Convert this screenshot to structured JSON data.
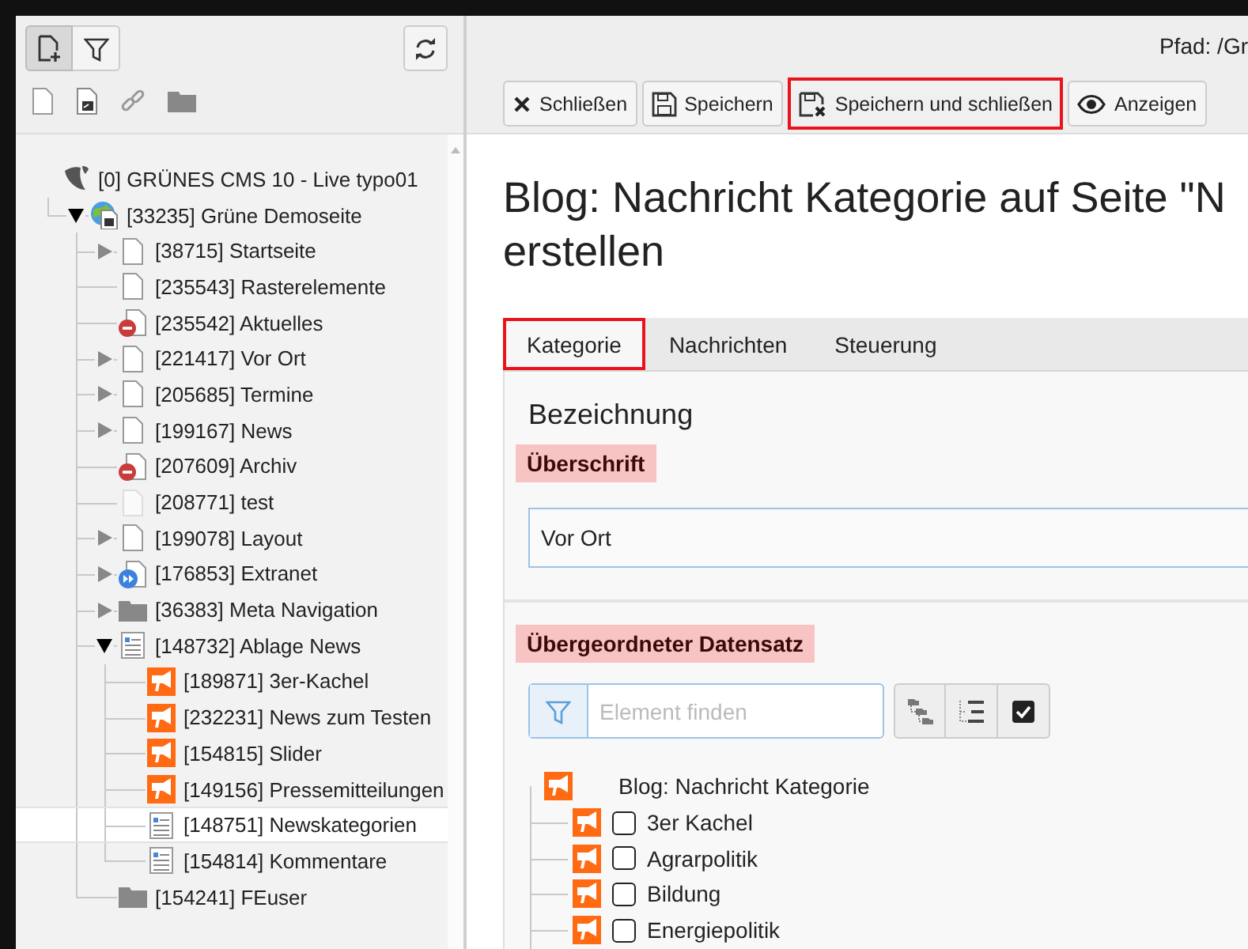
{
  "page_tree": {
    "items": [
      {
        "label": "[0] GRÜNES CMS 10 - Live typo01",
        "kind": "logo",
        "selected": false,
        "children": [
          {
            "label": "[33235] Grüne Demoseite",
            "kind": "globe-page",
            "expandable": true,
            "expanded": true,
            "selected": false,
            "children": [
              {
                "label": "[38715] Startseite",
                "kind": "page",
                "expandable": true,
                "expanded": false,
                "selected": false
              },
              {
                "label": "[235543] Rasterelemente",
                "kind": "page",
                "expandable": false,
                "expanded": false,
                "selected": false
              },
              {
                "label": "[235542] Aktuelles",
                "kind": "page-blocked",
                "expandable": false,
                "expanded": false,
                "selected": false
              },
              {
                "label": "[221417] Vor Ort",
                "kind": "page",
                "expandable": true,
                "expanded": false,
                "selected": false
              },
              {
                "label": "[205685] Termine",
                "kind": "page",
                "expandable": true,
                "expanded": false,
                "selected": false
              },
              {
                "label": "[199167] News",
                "kind": "page",
                "expandable": true,
                "expanded": false,
                "selected": false
              },
              {
                "label": "[207609] Archiv",
                "kind": "page-blocked",
                "expandable": false,
                "expanded": false,
                "selected": false
              },
              {
                "label": "[208771] test",
                "kind": "page-faded",
                "expandable": false,
                "expanded": false,
                "selected": false
              },
              {
                "label": "[199078] Layout",
                "kind": "page",
                "expandable": true,
                "expanded": false,
                "selected": false
              },
              {
                "label": "[176853] Extranet",
                "kind": "page-forward",
                "expandable": true,
                "expanded": false,
                "selected": false
              },
              {
                "label": "[36383] Meta Navigation",
                "kind": "folder",
                "expandable": true,
                "expanded": false,
                "selected": false
              },
              {
                "label": "[148732] Ablage News",
                "kind": "list-page",
                "expandable": true,
                "expanded": true,
                "selected": false,
                "children": [
                  {
                    "label": "[189871] 3er-Kachel",
                    "kind": "megaphone",
                    "expandable": false,
                    "expanded": false,
                    "selected": false
                  },
                  {
                    "label": "[232231] News zum Testen",
                    "kind": "megaphone",
                    "expandable": false,
                    "expanded": false,
                    "selected": false
                  },
                  {
                    "label": "[154815] Slider",
                    "kind": "megaphone",
                    "expandable": false,
                    "expanded": false,
                    "selected": false
                  },
                  {
                    "label": "[149156] Pressemitteilungen",
                    "kind": "megaphone",
                    "expandable": false,
                    "expanded": false,
                    "selected": false
                  },
                  {
                    "label": "[148751] Newskategorien",
                    "kind": "list-page",
                    "expandable": false,
                    "expanded": false,
                    "selected": true
                  },
                  {
                    "label": "[154814] Kommentare",
                    "kind": "list-page",
                    "expandable": false,
                    "expanded": false,
                    "selected": false
                  }
                ]
              },
              {
                "label": "[154241] FEuser",
                "kind": "folder",
                "expandable": false,
                "expanded": false,
                "selected": false
              }
            ]
          }
        ]
      }
    ]
  },
  "path": "Pfad: /Gr",
  "buttons": [
    {
      "label": "Schließen",
      "kind": "close",
      "highlighted": false
    },
    {
      "label": "Speichern",
      "kind": "save",
      "highlighted": false
    },
    {
      "label": "Speichern und schließen",
      "kind": "save-close",
      "highlighted": true
    },
    {
      "label": "Anzeigen",
      "kind": "view",
      "highlighted": false
    }
  ],
  "title_lines": [
    "Blog: Nachricht Kategorie auf Seite \"N",
    "erstellen"
  ],
  "tabs": [
    {
      "label": "Kategorie",
      "selected": true,
      "highlighted": true
    },
    {
      "label": "Nachrichten",
      "selected": false,
      "highlighted": false
    },
    {
      "label": "Steuerung",
      "selected": false,
      "highlighted": false
    }
  ],
  "form": {
    "section_title": "Bezeichnung",
    "fields": [
      {
        "kind": "text",
        "label": "Überschrift",
        "invalid": true,
        "value": "Vor Ort"
      },
      {
        "kind": "category-tree",
        "label": "Übergeordneter Datensatz",
        "invalid": true,
        "filter": {
          "placeholder": "Element finden"
        },
        "root": {
          "label": "Blog: Nachricht Kategorie",
          "children": [
            {
              "label": "3er Kachel",
              "checked": false
            },
            {
              "label": "Agrarpolitik",
              "checked": false
            },
            {
              "label": "Bildung",
              "checked": false
            },
            {
              "label": "Energiepolitik",
              "checked": false
            }
          ]
        }
      }
    ]
  }
}
